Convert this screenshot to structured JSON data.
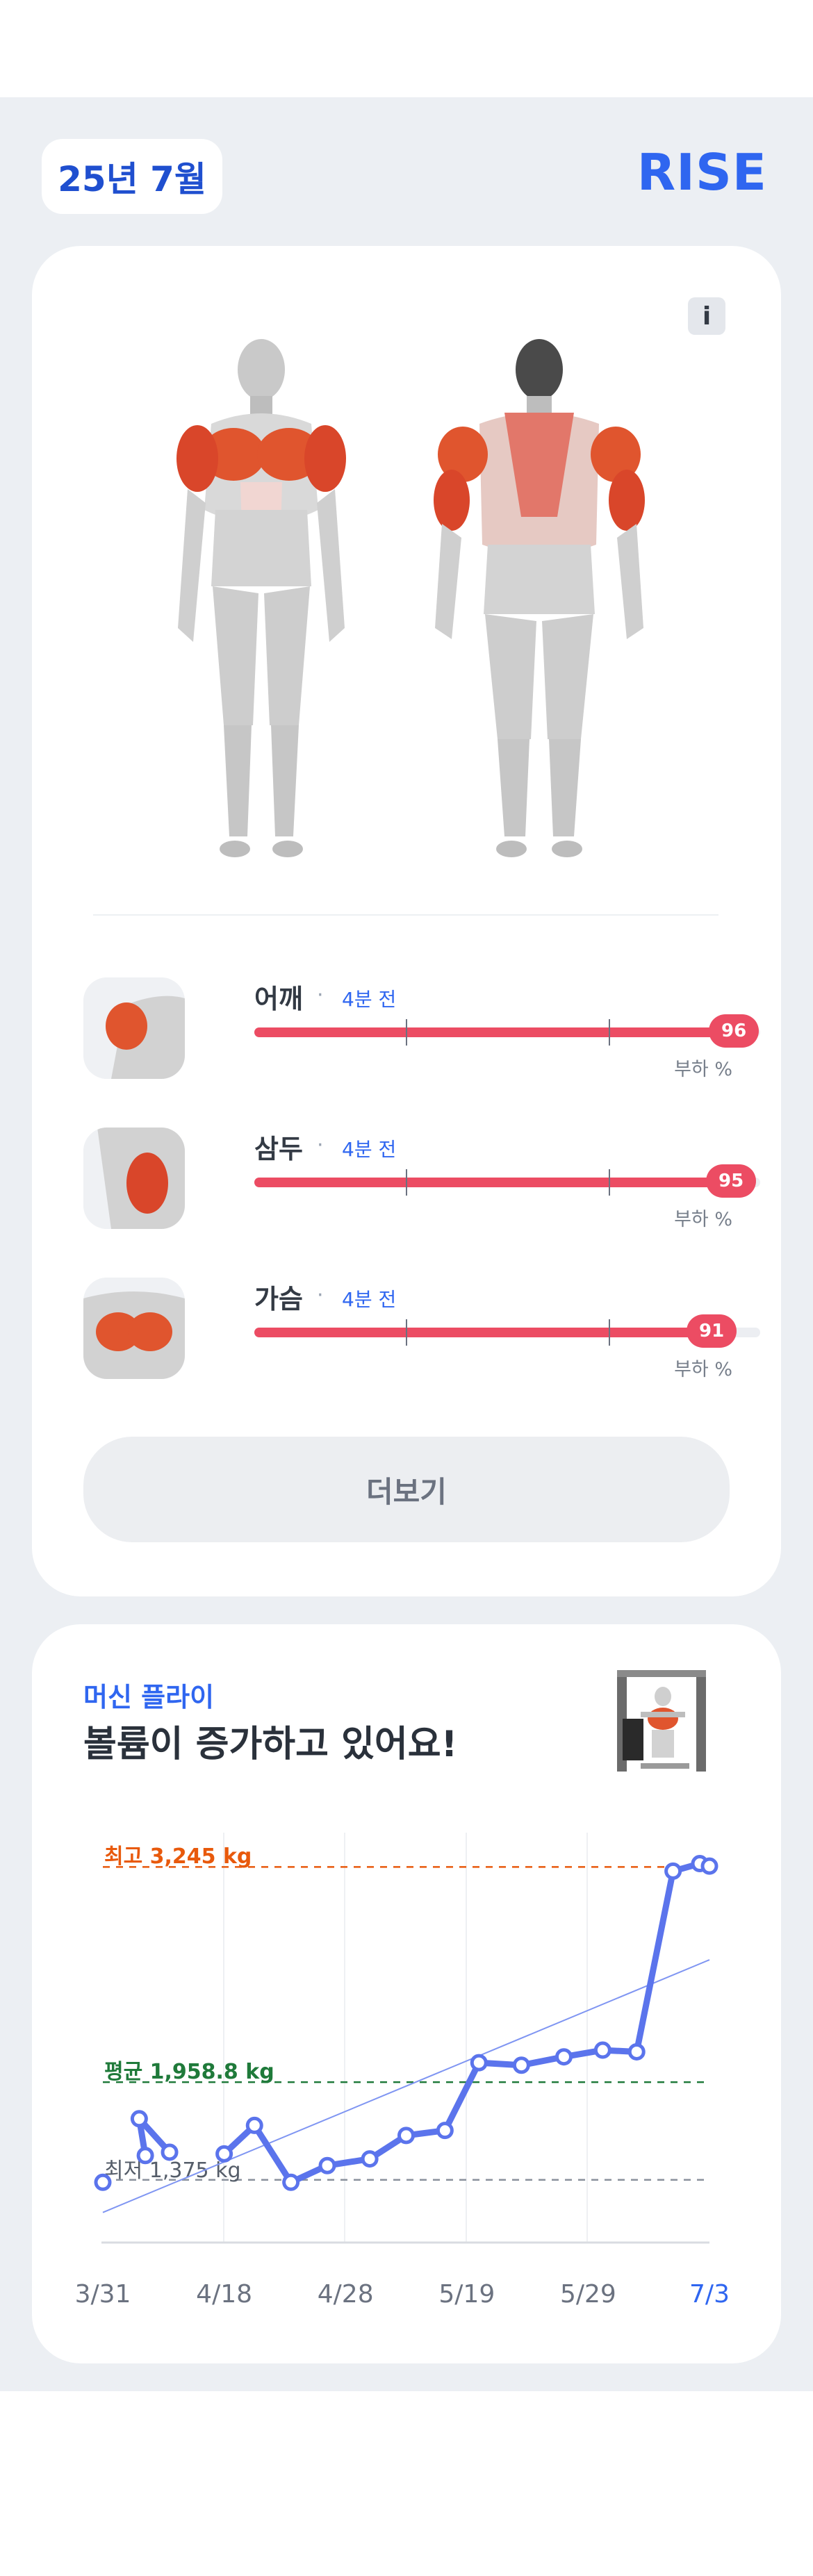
{
  "header": {
    "date": "25년 7월",
    "brand": "RISE"
  },
  "muscle_card": {
    "info_label": "i",
    "rows": [
      {
        "name": "어깨",
        "time": "4분 전",
        "load": 96,
        "load_label": "부하 %"
      },
      {
        "name": "삼두",
        "time": "4분 전",
        "load": 95,
        "load_label": "부하 %"
      },
      {
        "name": "가슴",
        "time": "4분 전",
        "load": 91,
        "load_label": "부하 %"
      }
    ],
    "more_label": "더보기"
  },
  "chart_card": {
    "machine": "머신 플라이",
    "headline": "볼륨이 증가하고 있어요!",
    "max_label": "최고 3,245 kg",
    "avg_label": "평균 1,958.8 kg",
    "min_label": "최저 1,375 kg"
  },
  "chart_data": {
    "type": "line",
    "unit": "kg",
    "x_ticks": [
      "3/31",
      "4/18",
      "4/28",
      "5/19",
      "5/29",
      "7/3"
    ],
    "ylim": [
      1000,
      3450
    ],
    "reference_lines": {
      "max": 3245,
      "avg": 1958.8,
      "min": 1375
    },
    "segments": [
      [
        {
          "x": 0.0,
          "y": 1360
        }
      ],
      [
        {
          "x": 0.35,
          "y": 1520
        },
        {
          "x": 0.3,
          "y": 1740
        },
        {
          "x": 0.55,
          "y": 1540
        }
      ],
      [
        {
          "x": 1.0,
          "y": 1530
        },
        {
          "x": 1.25,
          "y": 1700
        },
        {
          "x": 1.55,
          "y": 1360
        },
        {
          "x": 1.85,
          "y": 1460
        },
        {
          "x": 2.2,
          "y": 1500
        },
        {
          "x": 2.5,
          "y": 1640
        },
        {
          "x": 2.82,
          "y": 1670
        },
        {
          "x": 3.1,
          "y": 2075
        },
        {
          "x": 3.45,
          "y": 2060
        },
        {
          "x": 3.8,
          "y": 2110
        },
        {
          "x": 4.12,
          "y": 2150
        },
        {
          "x": 4.4,
          "y": 2140
        },
        {
          "x": 4.7,
          "y": 3220
        },
        {
          "x": 4.92,
          "y": 3265
        },
        {
          "x": 5.0,
          "y": 3250
        }
      ]
    ],
    "trend": {
      "from": {
        "x": 0.0,
        "y": 1180
      },
      "to": {
        "x": 5.0,
        "y": 2690
      }
    },
    "colors": {
      "line": "#5b74ec",
      "max": "#e8590c",
      "avg": "#1f7a3a",
      "min": "#8a919c",
      "load_bar": "#ec4c63"
    }
  }
}
